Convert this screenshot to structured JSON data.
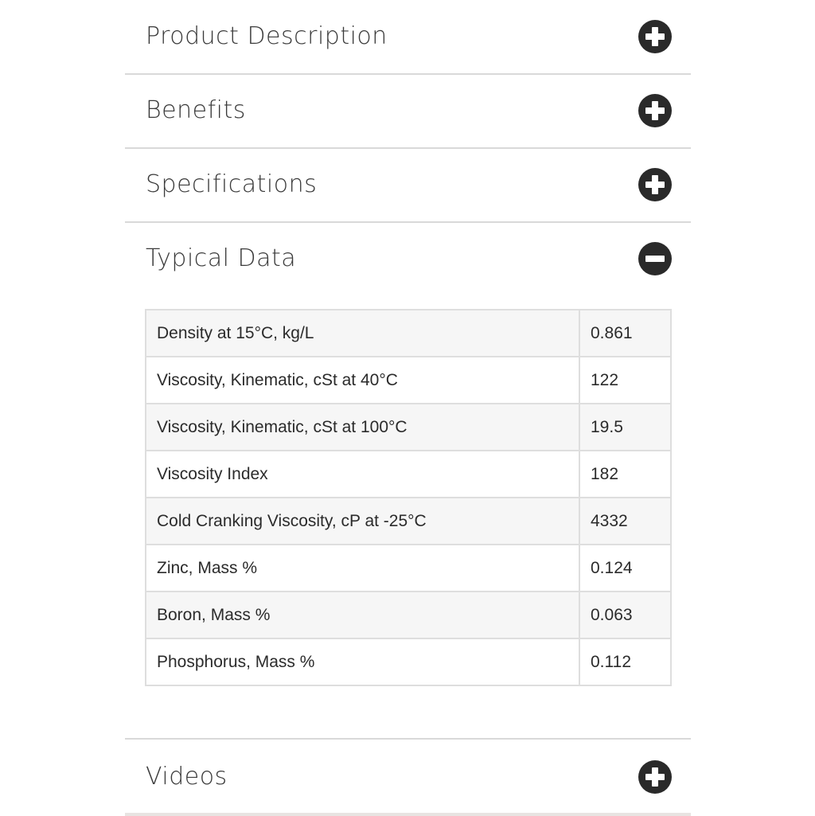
{
  "accordion": {
    "sections": [
      {
        "label": "Product Description",
        "expanded": false,
        "icon": "plus-circle-icon"
      },
      {
        "label": "Benefits",
        "expanded": false,
        "icon": "plus-circle-icon"
      },
      {
        "label": "Specifications",
        "expanded": false,
        "icon": "plus-circle-icon"
      },
      {
        "label": "Typical Data",
        "expanded": true,
        "icon": "minus-circle-icon"
      },
      {
        "label": "Videos",
        "expanded": false,
        "icon": "plus-circle-icon"
      }
    ]
  },
  "typical_data": {
    "rows": [
      {
        "property": "Density at 15°C, kg/L",
        "value": "0.861"
      },
      {
        "property": "Viscosity, Kinematic, cSt at 40°C",
        "value": "122"
      },
      {
        "property": "Viscosity, Kinematic, cSt at 100°C",
        "value": "19.5"
      },
      {
        "property": "Viscosity Index",
        "value": "182"
      },
      {
        "property": "Cold Cranking Viscosity, cP at -25°C",
        "value": "4332"
      },
      {
        "property": "Zinc, Mass %",
        "value": "0.124"
      },
      {
        "property": "Boron, Mass %",
        "value": "0.063"
      },
      {
        "property": "Phosphorus, Mass %",
        "value": "0.112"
      }
    ]
  },
  "colors": {
    "icon_fill": "#2a2a2a",
    "divider": "#d9d9d9",
    "row_alt": "#f6f6f6"
  }
}
